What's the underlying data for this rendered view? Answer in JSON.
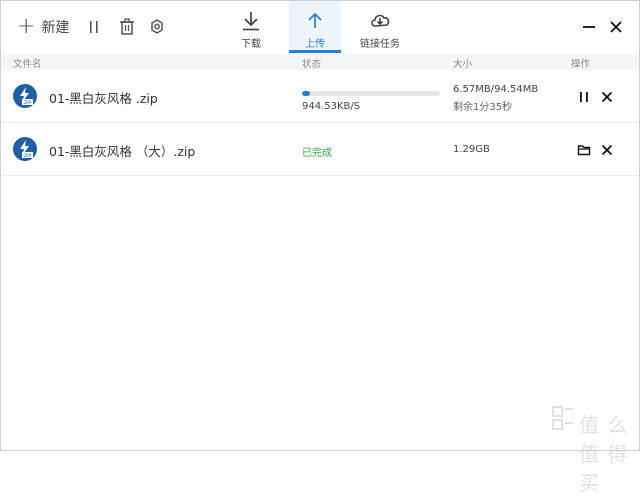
{
  "toolbar": {
    "new_label": "新建",
    "tabs": [
      {
        "label": "下载",
        "icon": "download-icon",
        "active": false
      },
      {
        "label": "上传",
        "icon": "upload-icon",
        "active": true
      },
      {
        "label": "链接任务",
        "icon": "cloud-download-icon",
        "active": false
      }
    ],
    "accent": "#1f84d8"
  },
  "columns": {
    "name": "文件名",
    "status": "状态",
    "size": "大小",
    "ops": "操作"
  },
  "rows": [
    {
      "file": "01-黑白灰风格 .zip",
      "progress": 0.06,
      "speed": "944.53KB/S",
      "size": "6.57MB/94.54MB",
      "remaining": "剩余1分35秒"
    },
    {
      "file": "01-黑白灰风格 （大）.zip",
      "status": "已完成",
      "status_color": "#2eaa3c",
      "size": "1.29GB"
    }
  ],
  "watermark": {
    "text": "值 么 值 得 买"
  }
}
